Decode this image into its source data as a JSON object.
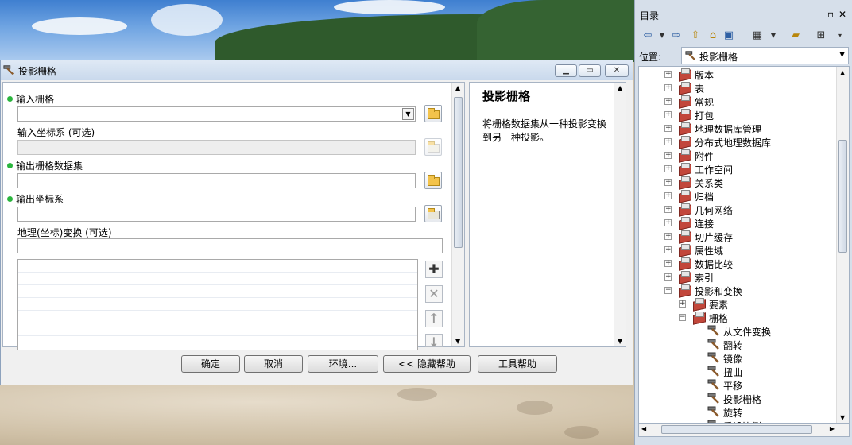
{
  "dialog": {
    "title": "投影栅格",
    "params": {
      "input_raster": "输入栅格",
      "input_cs": "输入坐标系 (可选)",
      "output_dataset": "输出栅格数据集",
      "output_cs": "输出坐标系",
      "geo_transform": "地理(坐标)变换 (可选)"
    },
    "help": {
      "title": "投影栅格",
      "text": "将栅格数据集从一种投影变换到另一种投影。"
    },
    "buttons": {
      "ok": "确定",
      "cancel": "取消",
      "env": "环境...",
      "hide_help": "<< 隐藏帮助",
      "tool_help": "工具帮助"
    }
  },
  "catalog": {
    "title": "目录",
    "location_label": "位置:",
    "location_value": "投影栅格",
    "tree": [
      {
        "label": "版本",
        "level": 0,
        "kind": "toolbox",
        "expander": "+"
      },
      {
        "label": "表",
        "level": 0,
        "kind": "toolbox",
        "expander": "+"
      },
      {
        "label": "常规",
        "level": 0,
        "kind": "toolbox",
        "expander": "+"
      },
      {
        "label": "打包",
        "level": 0,
        "kind": "toolbox",
        "expander": "+"
      },
      {
        "label": "地理数据库管理",
        "level": 0,
        "kind": "toolbox",
        "expander": "+"
      },
      {
        "label": "分布式地理数据库",
        "level": 0,
        "kind": "toolbox",
        "expander": "+"
      },
      {
        "label": "附件",
        "level": 0,
        "kind": "toolbox",
        "expander": "+"
      },
      {
        "label": "工作空间",
        "level": 0,
        "kind": "toolbox",
        "expander": "+"
      },
      {
        "label": "关系类",
        "level": 0,
        "kind": "toolbox",
        "expander": "+"
      },
      {
        "label": "归档",
        "level": 0,
        "kind": "toolbox",
        "expander": "+"
      },
      {
        "label": "几何网络",
        "level": 0,
        "kind": "toolbox",
        "expander": "+"
      },
      {
        "label": "连接",
        "level": 0,
        "kind": "toolbox",
        "expander": "+"
      },
      {
        "label": "切片缓存",
        "level": 0,
        "kind": "toolbox",
        "expander": "+"
      },
      {
        "label": "属性域",
        "level": 0,
        "kind": "toolbox",
        "expander": "+"
      },
      {
        "label": "数据比较",
        "level": 0,
        "kind": "toolbox",
        "expander": "+"
      },
      {
        "label": "索引",
        "level": 0,
        "kind": "toolbox",
        "expander": "+"
      },
      {
        "label": "投影和变换",
        "level": 0,
        "kind": "toolbox",
        "expander": "-"
      },
      {
        "label": "要素",
        "level": 1,
        "kind": "toolbox",
        "expander": "+"
      },
      {
        "label": "栅格",
        "level": 1,
        "kind": "toolbox",
        "expander": "-"
      },
      {
        "label": "从文件变换",
        "level": 2,
        "kind": "tool",
        "expander": ""
      },
      {
        "label": "翻转",
        "level": 2,
        "kind": "tool",
        "expander": ""
      },
      {
        "label": "镜像",
        "level": 2,
        "kind": "tool",
        "expander": ""
      },
      {
        "label": "扭曲",
        "level": 2,
        "kind": "tool",
        "expander": ""
      },
      {
        "label": "平移",
        "level": 2,
        "kind": "tool",
        "expander": ""
      },
      {
        "label": "投影栅格",
        "level": 2,
        "kind": "tool",
        "expander": ""
      },
      {
        "label": "旋转",
        "level": 2,
        "kind": "tool",
        "expander": ""
      },
      {
        "label": "重设比例",
        "level": 2,
        "kind": "tool",
        "expander": ""
      }
    ]
  }
}
